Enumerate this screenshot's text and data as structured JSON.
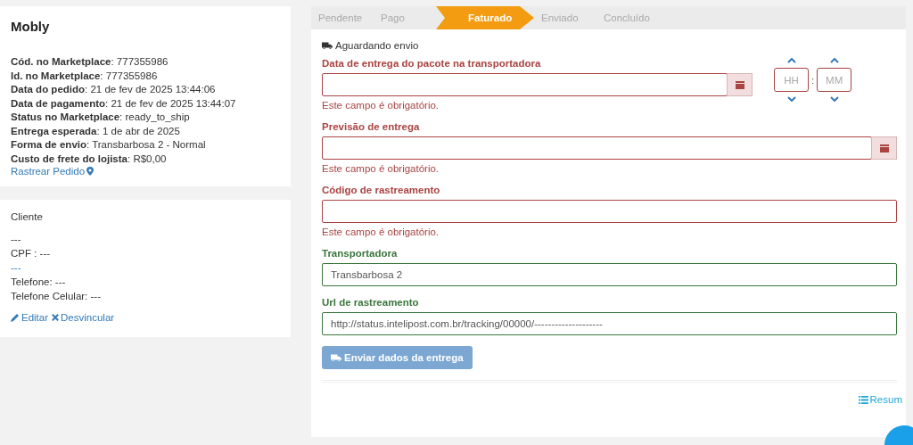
{
  "store_card": {
    "title": "Mobly",
    "details": [
      "**Cód. no Marketplace**: 777355986",
      "**Id. no Marketplace**: 777355986",
      "**Data do pedido**: 21 de fev de 2025 13:44:06",
      "**Data de pagamento**: 21 de fev de 2025 13:44:07",
      "**Status no Marketplace**: ready_to_ship",
      "**Entrega esperada**: 1 de abr de 2025",
      "**Forma de envio**: Transbarbosa 2 - Normal",
      "**Custo de frete do lojista**: R$0,00"
    ],
    "track_link": "Rastrear Pedido"
  },
  "client_card": {
    "title": "Cliente",
    "lines": [
      {
        "text": "---",
        "kind": "plain"
      },
      {
        "text": "CPF : ---",
        "kind": "plain"
      },
      {
        "text": "---",
        "kind": "link"
      },
      {
        "text": "Telefone: ---",
        "kind": "plain"
      },
      {
        "text": "Telefone Celular: ---",
        "kind": "plain"
      }
    ],
    "edit_link": "Editar",
    "unlink_link": "Desvincular"
  },
  "steps": [
    {
      "label": "Pendente",
      "selected": false
    },
    {
      "label": "Pago",
      "selected": false
    },
    {
      "label": "Faturado",
      "selected": true
    },
    {
      "label": "Enviado",
      "selected": false
    },
    {
      "label": "Concluído",
      "selected": false
    }
  ],
  "status": "Aguardando envio",
  "fields": [
    {
      "label": "Data de entrega do pacote na transportadora",
      "invalid": true,
      "kind": "datetime",
      "error": "Este campo é obrigatório.",
      "hour_placeholder": "HH",
      "time_separator": ":",
      "minute_placeholder": "MM"
    },
    {
      "label": "Previsão de entrega",
      "invalid": true,
      "kind": "date",
      "error": "Este campo é obrigatório."
    },
    {
      "label": "Código de rastreamento",
      "invalid": true,
      "kind": "text",
      "error": "Este campo é obrigatório."
    },
    {
      "label": "Transportadora",
      "invalid": false,
      "kind": "text",
      "value": "Transbarbosa 2"
    },
    {
      "label": "Url de rastreamento",
      "invalid": false,
      "kind": "text",
      "value": "http://status.intelipost.com.br/tracking/00000/--------------------"
    }
  ],
  "submit_button": {
    "label": "Enviar dados da entrega",
    "disabled": true
  },
  "summary_link": "Resum"
}
